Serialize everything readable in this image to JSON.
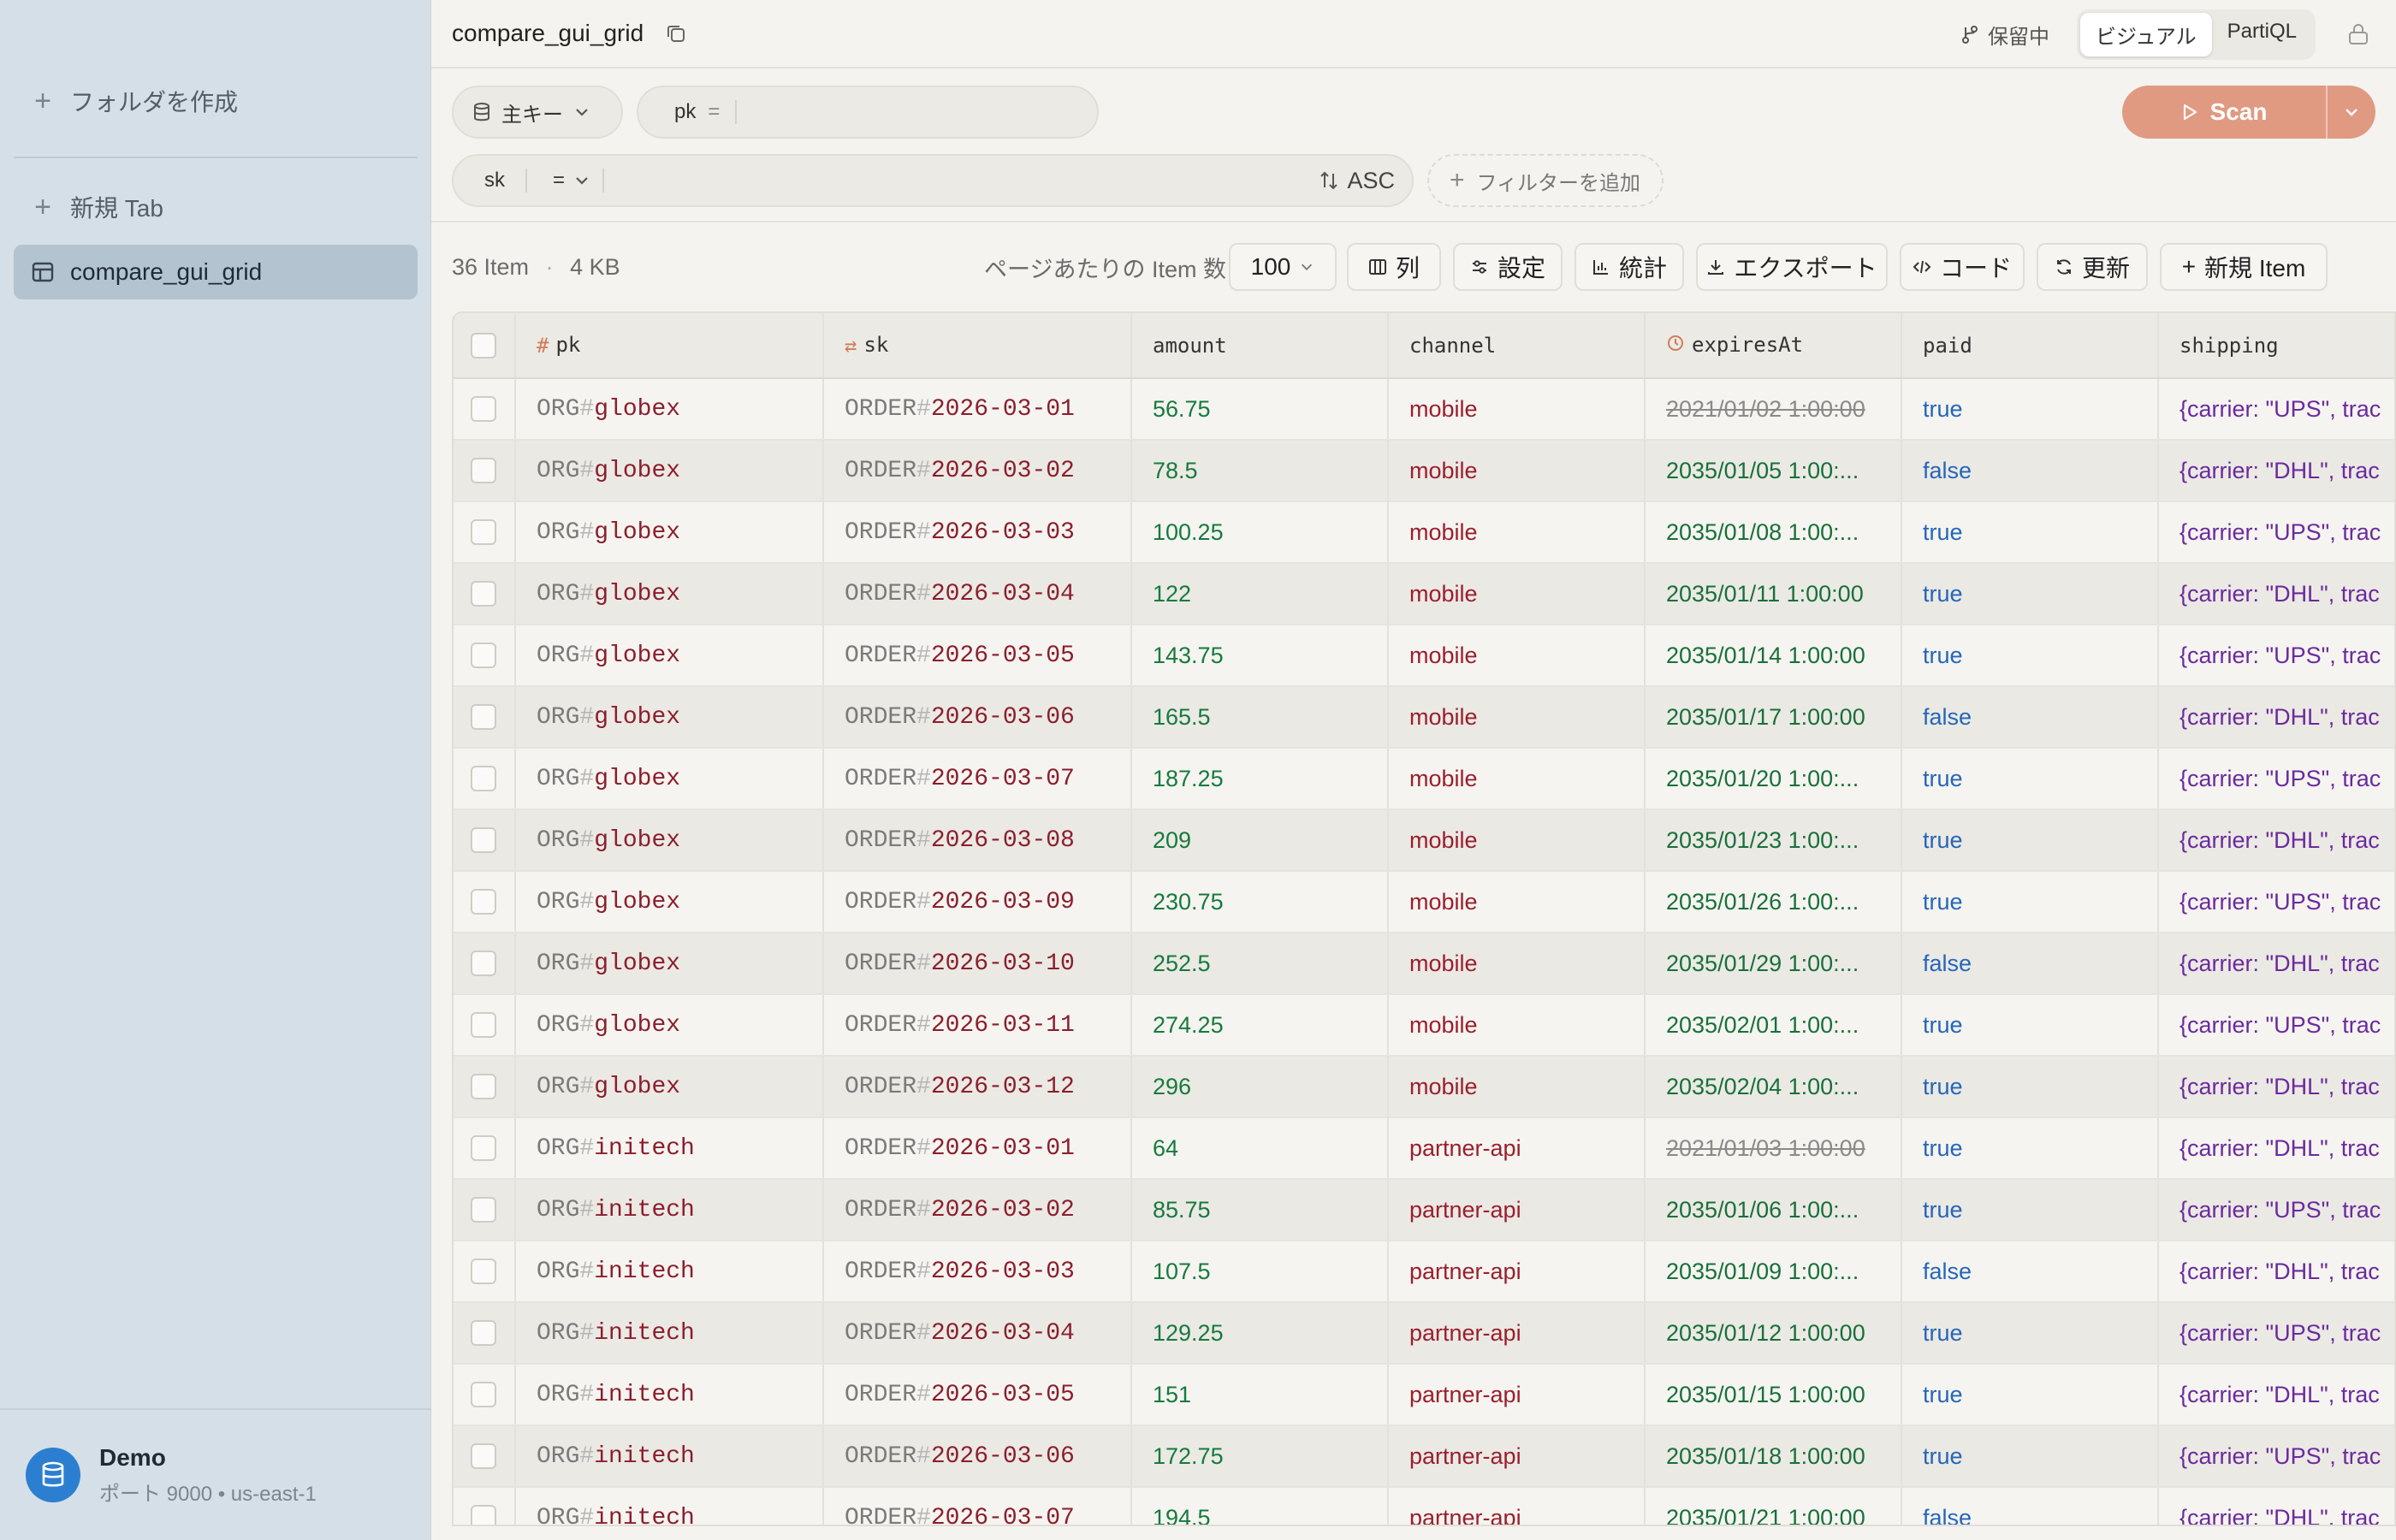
{
  "sidebar": {
    "create_folder": "フォルダを作成",
    "new_tab": "新規 Tab",
    "active_table": "compare_gui_grid",
    "footer_title": "Demo",
    "footer_sub": "ポート 9000 • us-east-1"
  },
  "titlebar": {
    "title": "compare_gui_grid",
    "pending": "保留中",
    "mode_visual": "ビジュアル",
    "mode_partiql": "PartiQL"
  },
  "query": {
    "key_selector": "主キー",
    "pk_label": "pk",
    "pk_op": "=",
    "sk_label": "sk",
    "sk_op": "=",
    "sort": "ASC",
    "add_filter": "フィルターを追加",
    "scan": "Scan"
  },
  "toolbar": {
    "item_count": "36 Item",
    "size": "4 KB",
    "per_page_label": "ページあたりの Item 数",
    "per_page_value": "100",
    "columns": "列",
    "settings": "設定",
    "stats": "統計",
    "export": "エクスポート",
    "code": "コード",
    "refresh": "更新",
    "new_item": "新規 Item"
  },
  "table": {
    "headers": [
      "pk",
      "sk",
      "amount",
      "channel",
      "expiresAt",
      "paid",
      "shipping"
    ],
    "rows": [
      {
        "pk_prefix": "ORG",
        "pk": "globex",
        "sk_prefix": "ORDER",
        "sk": "2026-03-01",
        "amount": "56.75",
        "channel": "mobile",
        "expiresAt": "2021/01/02 1:00:00",
        "expired": true,
        "paid": "true",
        "shipping": "{carrier: \"UPS\", trac"
      },
      {
        "pk_prefix": "ORG",
        "pk": "globex",
        "sk_prefix": "ORDER",
        "sk": "2026-03-02",
        "amount": "78.5",
        "channel": "mobile",
        "expiresAt": "2035/01/05 1:00:...",
        "expired": false,
        "paid": "false",
        "shipping": "{carrier: \"DHL\", trac"
      },
      {
        "pk_prefix": "ORG",
        "pk": "globex",
        "sk_prefix": "ORDER",
        "sk": "2026-03-03",
        "amount": "100.25",
        "channel": "mobile",
        "expiresAt": "2035/01/08 1:00:...",
        "expired": false,
        "paid": "true",
        "shipping": "{carrier: \"UPS\", trac"
      },
      {
        "pk_prefix": "ORG",
        "pk": "globex",
        "sk_prefix": "ORDER",
        "sk": "2026-03-04",
        "amount": "122",
        "channel": "mobile",
        "expiresAt": "2035/01/11 1:00:00",
        "expired": false,
        "paid": "true",
        "shipping": "{carrier: \"DHL\", trac"
      },
      {
        "pk_prefix": "ORG",
        "pk": "globex",
        "sk_prefix": "ORDER",
        "sk": "2026-03-05",
        "amount": "143.75",
        "channel": "mobile",
        "expiresAt": "2035/01/14 1:00:00",
        "expired": false,
        "paid": "true",
        "shipping": "{carrier: \"UPS\", trac"
      },
      {
        "pk_prefix": "ORG",
        "pk": "globex",
        "sk_prefix": "ORDER",
        "sk": "2026-03-06",
        "amount": "165.5",
        "channel": "mobile",
        "expiresAt": "2035/01/17 1:00:00",
        "expired": false,
        "paid": "false",
        "shipping": "{carrier: \"DHL\", trac"
      },
      {
        "pk_prefix": "ORG",
        "pk": "globex",
        "sk_prefix": "ORDER",
        "sk": "2026-03-07",
        "amount": "187.25",
        "channel": "mobile",
        "expiresAt": "2035/01/20 1:00:...",
        "expired": false,
        "paid": "true",
        "shipping": "{carrier: \"UPS\", trac"
      },
      {
        "pk_prefix": "ORG",
        "pk": "globex",
        "sk_prefix": "ORDER",
        "sk": "2026-03-08",
        "amount": "209",
        "channel": "mobile",
        "expiresAt": "2035/01/23 1:00:...",
        "expired": false,
        "paid": "true",
        "shipping": "{carrier: \"DHL\", trac"
      },
      {
        "pk_prefix": "ORG",
        "pk": "globex",
        "sk_prefix": "ORDER",
        "sk": "2026-03-09",
        "amount": "230.75",
        "channel": "mobile",
        "expiresAt": "2035/01/26 1:00:...",
        "expired": false,
        "paid": "true",
        "shipping": "{carrier: \"UPS\", trac"
      },
      {
        "pk_prefix": "ORG",
        "pk": "globex",
        "sk_prefix": "ORDER",
        "sk": "2026-03-10",
        "amount": "252.5",
        "channel": "mobile",
        "expiresAt": "2035/01/29 1:00:...",
        "expired": false,
        "paid": "false",
        "shipping": "{carrier: \"DHL\", trac"
      },
      {
        "pk_prefix": "ORG",
        "pk": "globex",
        "sk_prefix": "ORDER",
        "sk": "2026-03-11",
        "amount": "274.25",
        "channel": "mobile",
        "expiresAt": "2035/02/01 1:00:...",
        "expired": false,
        "paid": "true",
        "shipping": "{carrier: \"UPS\", trac"
      },
      {
        "pk_prefix": "ORG",
        "pk": "globex",
        "sk_prefix": "ORDER",
        "sk": "2026-03-12",
        "amount": "296",
        "channel": "mobile",
        "expiresAt": "2035/02/04 1:00:...",
        "expired": false,
        "paid": "true",
        "shipping": "{carrier: \"DHL\", trac"
      },
      {
        "pk_prefix": "ORG",
        "pk": "initech",
        "sk_prefix": "ORDER",
        "sk": "2026-03-01",
        "amount": "64",
        "channel": "partner-api",
        "expiresAt": "2021/01/03 1:00:00",
        "expired": true,
        "paid": "true",
        "shipping": "{carrier: \"DHL\", trac"
      },
      {
        "pk_prefix": "ORG",
        "pk": "initech",
        "sk_prefix": "ORDER",
        "sk": "2026-03-02",
        "amount": "85.75",
        "channel": "partner-api",
        "expiresAt": "2035/01/06 1:00:...",
        "expired": false,
        "paid": "true",
        "shipping": "{carrier: \"UPS\", trac"
      },
      {
        "pk_prefix": "ORG",
        "pk": "initech",
        "sk_prefix": "ORDER",
        "sk": "2026-03-03",
        "amount": "107.5",
        "channel": "partner-api",
        "expiresAt": "2035/01/09 1:00:...",
        "expired": false,
        "paid": "false",
        "shipping": "{carrier: \"DHL\", trac"
      },
      {
        "pk_prefix": "ORG",
        "pk": "initech",
        "sk_prefix": "ORDER",
        "sk": "2026-03-04",
        "amount": "129.25",
        "channel": "partner-api",
        "expiresAt": "2035/01/12 1:00:00",
        "expired": false,
        "paid": "true",
        "shipping": "{carrier: \"UPS\", trac"
      },
      {
        "pk_prefix": "ORG",
        "pk": "initech",
        "sk_prefix": "ORDER",
        "sk": "2026-03-05",
        "amount": "151",
        "channel": "partner-api",
        "expiresAt": "2035/01/15 1:00:00",
        "expired": false,
        "paid": "true",
        "shipping": "{carrier: \"DHL\", trac"
      },
      {
        "pk_prefix": "ORG",
        "pk": "initech",
        "sk_prefix": "ORDER",
        "sk": "2026-03-06",
        "amount": "172.75",
        "channel": "partner-api",
        "expiresAt": "2035/01/18 1:00:00",
        "expired": false,
        "paid": "true",
        "shipping": "{carrier: \"UPS\", trac"
      },
      {
        "pk_prefix": "ORG",
        "pk": "initech",
        "sk_prefix": "ORDER",
        "sk": "2026-03-07",
        "amount": "194.5",
        "channel": "partner-api",
        "expiresAt": "2035/01/21 1:00:00",
        "expired": false,
        "paid": "false",
        "shipping": "{carrier: \"DHL\", trac"
      }
    ]
  }
}
